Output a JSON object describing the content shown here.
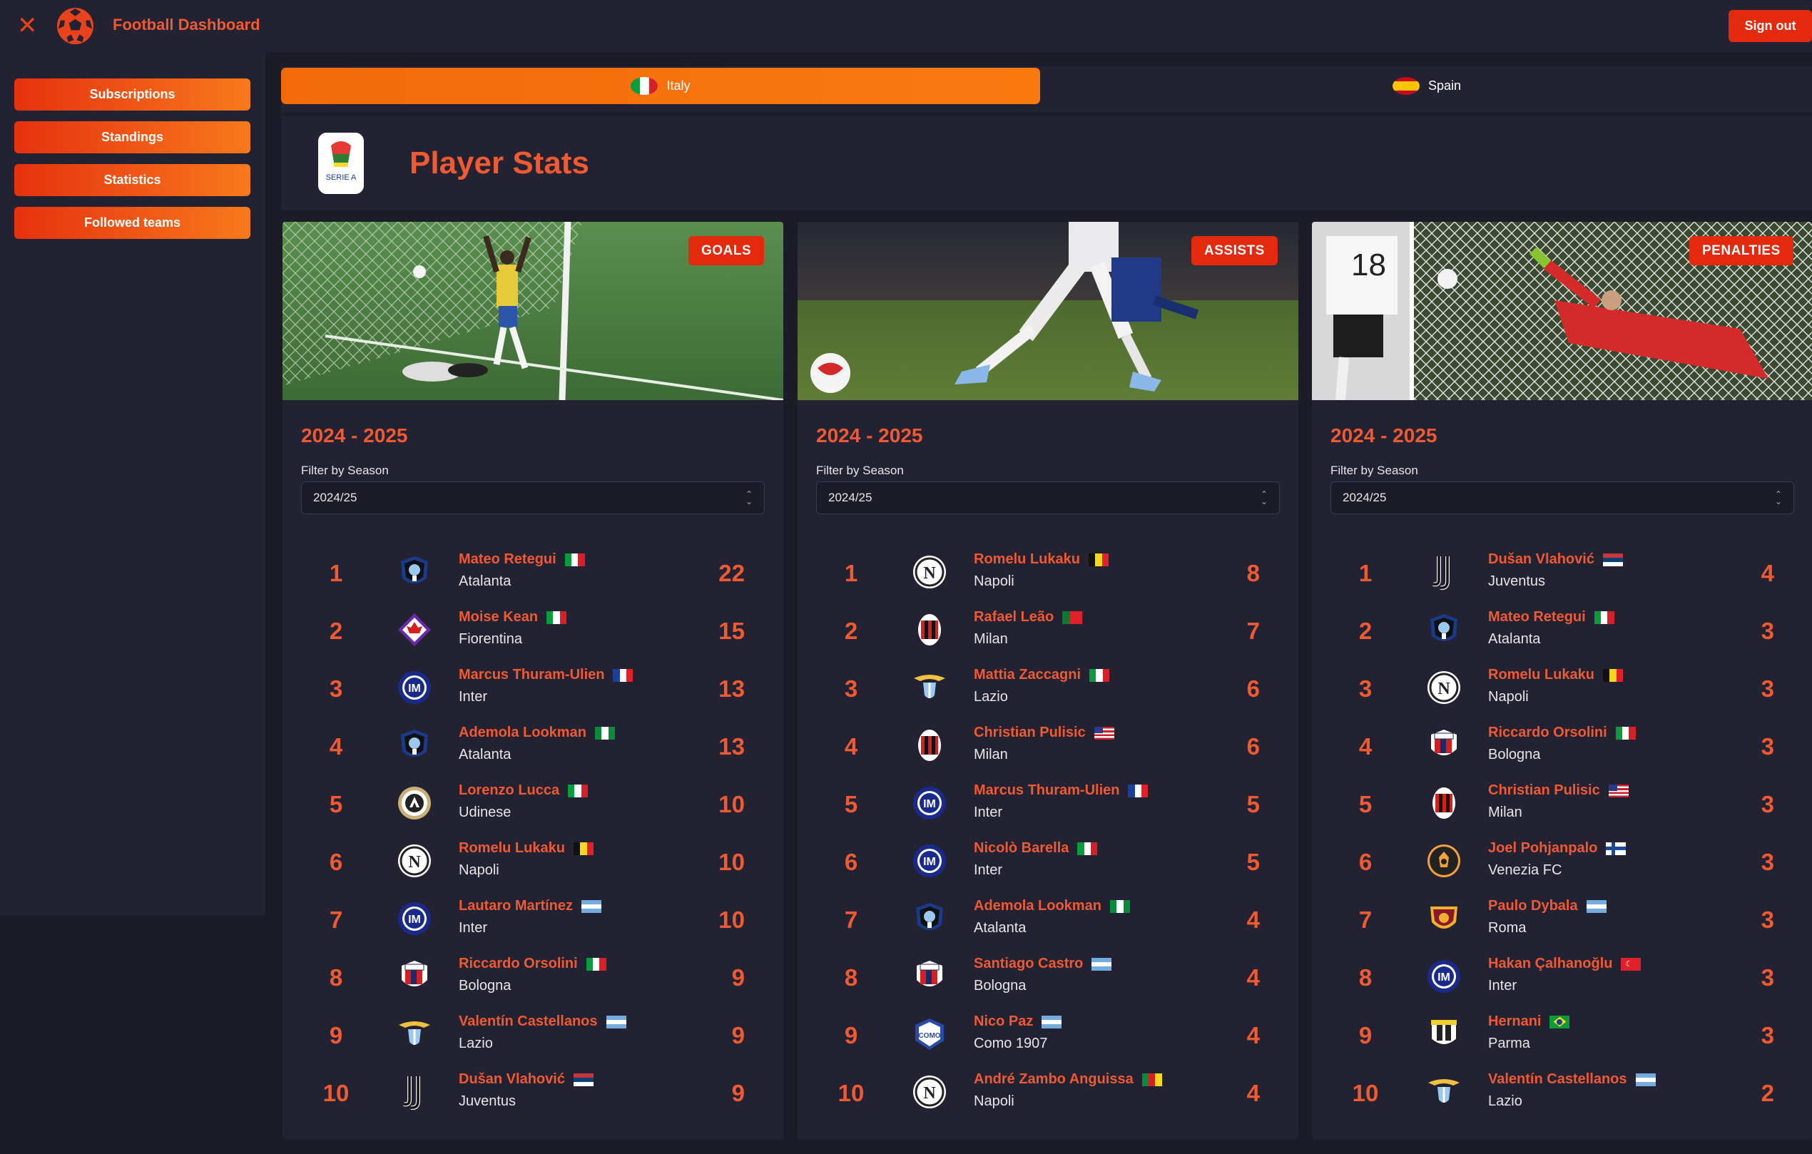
{
  "app": {
    "title": "Football Dashboard",
    "signout_label": "Sign out"
  },
  "sidebar": {
    "items": [
      {
        "label": "Subscriptions"
      },
      {
        "label": "Standings"
      },
      {
        "label": "Statistics"
      },
      {
        "label": "Followed teams"
      }
    ]
  },
  "country_tabs": [
    {
      "label": "Italy",
      "active": true
    },
    {
      "label": "Spain",
      "active": false
    }
  ],
  "header": {
    "title": "Player Stats",
    "league_logo_text": "SERIE A"
  },
  "cards": [
    {
      "badge": "GOALS",
      "season_title": "2024 - 2025",
      "filter_label": "Filter by Season",
      "selected_season": "2024/25",
      "rows": [
        {
          "rank": "1",
          "player": "Mateo Retegui",
          "team": "Atalanta",
          "value": "22",
          "flag": "italy",
          "crest": "atalanta"
        },
        {
          "rank": "2",
          "player": "Moise Kean",
          "team": "Fiorentina",
          "value": "15",
          "flag": "italy",
          "crest": "fiorentina"
        },
        {
          "rank": "3",
          "player": "Marcus Thuram-Ulien",
          "team": "Inter",
          "value": "13",
          "flag": "france",
          "crest": "inter"
        },
        {
          "rank": "4",
          "player": "Ademola Lookman",
          "team": "Atalanta",
          "value": "13",
          "flag": "nigeria",
          "crest": "atalanta"
        },
        {
          "rank": "5",
          "player": "Lorenzo Lucca",
          "team": "Udinese",
          "value": "10",
          "flag": "italy",
          "crest": "udinese"
        },
        {
          "rank": "6",
          "player": "Romelu Lukaku",
          "team": "Napoli",
          "value": "10",
          "flag": "belgium",
          "crest": "napoli"
        },
        {
          "rank": "7",
          "player": "Lautaro Martínez",
          "team": "Inter",
          "value": "10",
          "flag": "argentina",
          "crest": "inter"
        },
        {
          "rank": "8",
          "player": "Riccardo Orsolini",
          "team": "Bologna",
          "value": "9",
          "flag": "italy",
          "crest": "bologna"
        },
        {
          "rank": "9",
          "player": "Valentín Castellanos",
          "team": "Lazio",
          "value": "9",
          "flag": "argentina",
          "crest": "lazio"
        },
        {
          "rank": "10",
          "player": "Dušan Vlahović",
          "team": "Juventus",
          "value": "9",
          "flag": "serbia",
          "crest": "juventus"
        }
      ]
    },
    {
      "badge": "ASSISTS",
      "season_title": "2024 - 2025",
      "filter_label": "Filter by Season",
      "selected_season": "2024/25",
      "rows": [
        {
          "rank": "1",
          "player": "Romelu Lukaku",
          "team": "Napoli",
          "value": "8",
          "flag": "belgium",
          "crest": "napoli"
        },
        {
          "rank": "2",
          "player": "Rafael Leão",
          "team": "Milan",
          "value": "7",
          "flag": "portugal",
          "crest": "milan"
        },
        {
          "rank": "3",
          "player": "Mattia Zaccagni",
          "team": "Lazio",
          "value": "6",
          "flag": "italy",
          "crest": "lazio"
        },
        {
          "rank": "4",
          "player": "Christian Pulisic",
          "team": "Milan",
          "value": "6",
          "flag": "usa",
          "crest": "milan"
        },
        {
          "rank": "5",
          "player": "Marcus Thuram-Ulien",
          "team": "Inter",
          "value": "5",
          "flag": "france",
          "crest": "inter"
        },
        {
          "rank": "6",
          "player": "Nicolò Barella",
          "team": "Inter",
          "value": "5",
          "flag": "italy",
          "crest": "inter"
        },
        {
          "rank": "7",
          "player": "Ademola Lookman",
          "team": "Atalanta",
          "value": "4",
          "flag": "nigeria",
          "crest": "atalanta"
        },
        {
          "rank": "8",
          "player": "Santiago Castro",
          "team": "Bologna",
          "value": "4",
          "flag": "argentina",
          "crest": "bologna"
        },
        {
          "rank": "9",
          "player": "Nico Paz",
          "team": "Como 1907",
          "value": "4",
          "flag": "argentina",
          "crest": "como"
        },
        {
          "rank": "10",
          "player": "André Zambo Anguissa",
          "team": "Napoli",
          "value": "4",
          "flag": "cameroon",
          "crest": "napoli"
        }
      ]
    },
    {
      "badge": "PENALTIES",
      "season_title": "2024 - 2025",
      "filter_label": "Filter by Season",
      "selected_season": "2024/25",
      "rows": [
        {
          "rank": "1",
          "player": "Dušan Vlahović",
          "team": "Juventus",
          "value": "4",
          "flag": "serbia",
          "crest": "juventus"
        },
        {
          "rank": "2",
          "player": "Mateo Retegui",
          "team": "Atalanta",
          "value": "3",
          "flag": "italy",
          "crest": "atalanta"
        },
        {
          "rank": "3",
          "player": "Romelu Lukaku",
          "team": "Napoli",
          "value": "3",
          "flag": "belgium",
          "crest": "napoli"
        },
        {
          "rank": "4",
          "player": "Riccardo Orsolini",
          "team": "Bologna",
          "value": "3",
          "flag": "italy",
          "crest": "bologna"
        },
        {
          "rank": "5",
          "player": "Christian Pulisic",
          "team": "Milan",
          "value": "3",
          "flag": "usa",
          "crest": "milan"
        },
        {
          "rank": "6",
          "player": "Joel Pohjanpalo",
          "team": "Venezia FC",
          "value": "3",
          "flag": "finland",
          "crest": "venezia"
        },
        {
          "rank": "7",
          "player": "Paulo Dybala",
          "team": "Roma",
          "value": "3",
          "flag": "argentina",
          "crest": "roma"
        },
        {
          "rank": "8",
          "player": "Hakan Çalhanoğlu",
          "team": "Inter",
          "value": "3",
          "flag": "turkey",
          "crest": "inter"
        },
        {
          "rank": "9",
          "player": "Hernani",
          "team": "Parma",
          "value": "3",
          "flag": "brazil",
          "crest": "parma"
        },
        {
          "rank": "10",
          "player": "Valentín Castellanos",
          "team": "Lazio",
          "value": "2",
          "flag": "argentina",
          "crest": "lazio"
        }
      ]
    }
  ],
  "colors": {
    "accent": "#ef5a32",
    "button": "#e32a0e",
    "tab_active": "#f26a0a",
    "background": "#1c1c28",
    "panel": "#222232"
  }
}
